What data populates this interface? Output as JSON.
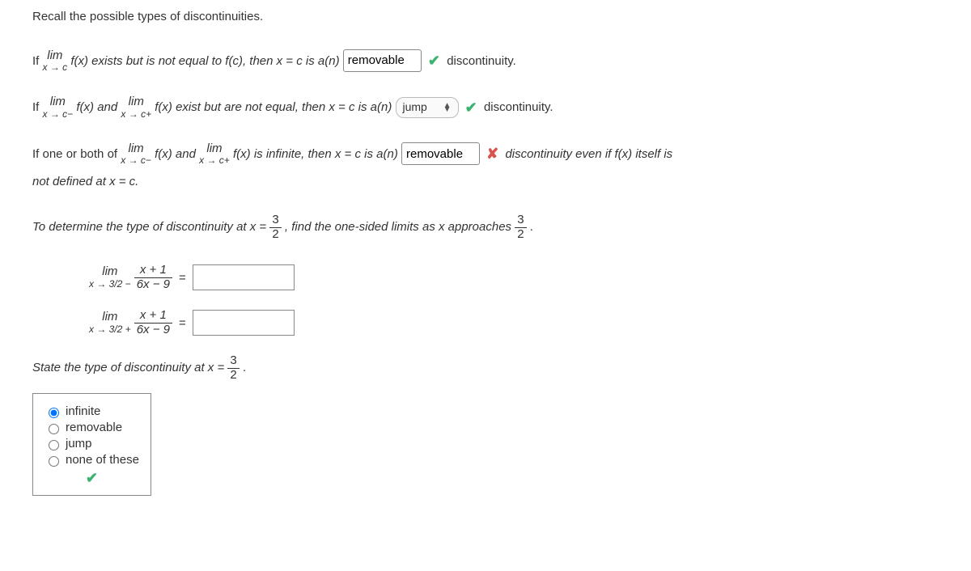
{
  "intro": "Recall the possible types of discontinuities.",
  "line1": {
    "prefix": "If ",
    "lim_main": "lim",
    "lim_sub": "x → c",
    "after_lim": " f(x) exists but is not equal to f(c), then x = c is a(n) ",
    "input_value": "removable",
    "trailing": "discontinuity."
  },
  "line2": {
    "prefix": "If  ",
    "lim1_main": "lim",
    "lim1_sub": "x → c−",
    "mid1": " f(x) and  ",
    "lim2_main": "lim",
    "lim2_sub": "x → c+",
    "mid2": " f(x) exist but are not equal, then x = c is a(n) ",
    "select_value": "jump",
    "trailing": "discontinuity."
  },
  "line3": {
    "prefix": "If one or both of  ",
    "lim1_main": "lim",
    "lim1_sub": "x → c−",
    "mid1": " f(x) and  ",
    "lim2_main": "lim",
    "lim2_sub": "x → c+",
    "mid2": " f(x) is infinite, then x = c is a(n) ",
    "input_value": "removable",
    "trailing1": "discontinuity even if f(x) itself is",
    "trailing2": "not defined at x = c."
  },
  "determine": {
    "pre": "To determine the type of discontinuity at x = ",
    "frac1_num": "3",
    "frac1_den": "2",
    "mid": ", find the one-sided limits as x approaches ",
    "frac2_num": "3",
    "frac2_den": "2",
    "post": "."
  },
  "limeq": {
    "lim": "lim",
    "sub_left": "x → 3/2 −",
    "sub_right": "x → 3/2 +",
    "numer": "x + 1",
    "denom": "6x − 9",
    "eq": "="
  },
  "state": {
    "pre": "State the type of discontinuity at x = ",
    "num": "3",
    "den": "2",
    "post": "."
  },
  "options": {
    "o1": "infinite",
    "o2": "removable",
    "o3": "jump",
    "o4": "none of these",
    "selected": "infinite"
  }
}
